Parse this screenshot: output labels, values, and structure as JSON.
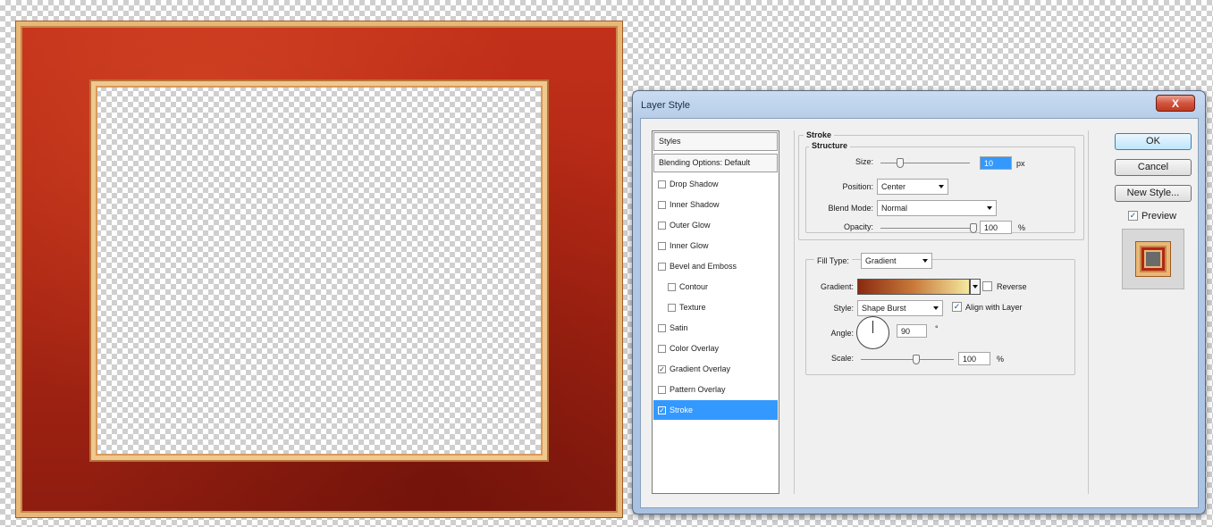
{
  "dialog": {
    "title": "Layer Style",
    "close_label": "X"
  },
  "styles_panel": {
    "header": "Styles",
    "blending_options": "Blending Options: Default",
    "items": [
      {
        "label": "Drop Shadow",
        "checked": false,
        "indent": false,
        "selected": false
      },
      {
        "label": "Inner Shadow",
        "checked": false,
        "indent": false,
        "selected": false
      },
      {
        "label": "Outer Glow",
        "checked": false,
        "indent": false,
        "selected": false
      },
      {
        "label": "Inner Glow",
        "checked": false,
        "indent": false,
        "selected": false
      },
      {
        "label": "Bevel and Emboss",
        "checked": false,
        "indent": false,
        "selected": false
      },
      {
        "label": "Contour",
        "checked": false,
        "indent": true,
        "selected": false
      },
      {
        "label": "Texture",
        "checked": false,
        "indent": true,
        "selected": false
      },
      {
        "label": "Satin",
        "checked": false,
        "indent": false,
        "selected": false
      },
      {
        "label": "Color Overlay",
        "checked": false,
        "indent": false,
        "selected": false
      },
      {
        "label": "Gradient Overlay",
        "checked": true,
        "indent": false,
        "selected": false
      },
      {
        "label": "Pattern Overlay",
        "checked": false,
        "indent": false,
        "selected": false
      },
      {
        "label": "Stroke",
        "checked": true,
        "indent": false,
        "selected": true
      }
    ]
  },
  "stroke": {
    "section_title": "Stroke",
    "structure_title": "Structure",
    "size_label": "Size:",
    "size_value": "10",
    "size_unit": "px",
    "position_label": "Position:",
    "position_value": "Center",
    "blend_mode_label": "Blend Mode:",
    "blend_mode_value": "Normal",
    "opacity_label": "Opacity:",
    "opacity_value": "100",
    "opacity_unit": "%",
    "fill_type_label": "Fill Type:",
    "fill_type_value": "Gradient",
    "gradient_label": "Gradient:",
    "reverse_label": "Reverse",
    "reverse_checked": false,
    "style_label": "Style:",
    "style_value": "Shape Burst",
    "align_label": "Align with Layer",
    "align_checked": true,
    "angle_label": "Angle:",
    "angle_value": "90",
    "angle_unit": "°",
    "scale_label": "Scale:",
    "scale_value": "100",
    "scale_unit": "%",
    "gradient_colors": [
      "#8a2a10",
      "#c87a3a",
      "#f4e8a0"
    ]
  },
  "buttons": {
    "ok": "OK",
    "cancel": "Cancel",
    "new_style": "New Style...",
    "preview_label": "Preview",
    "preview_checked": true
  },
  "colors": {
    "frame_red": "#b02714",
    "frame_gold": "#e8b878",
    "selection_blue": "#3399ff"
  }
}
